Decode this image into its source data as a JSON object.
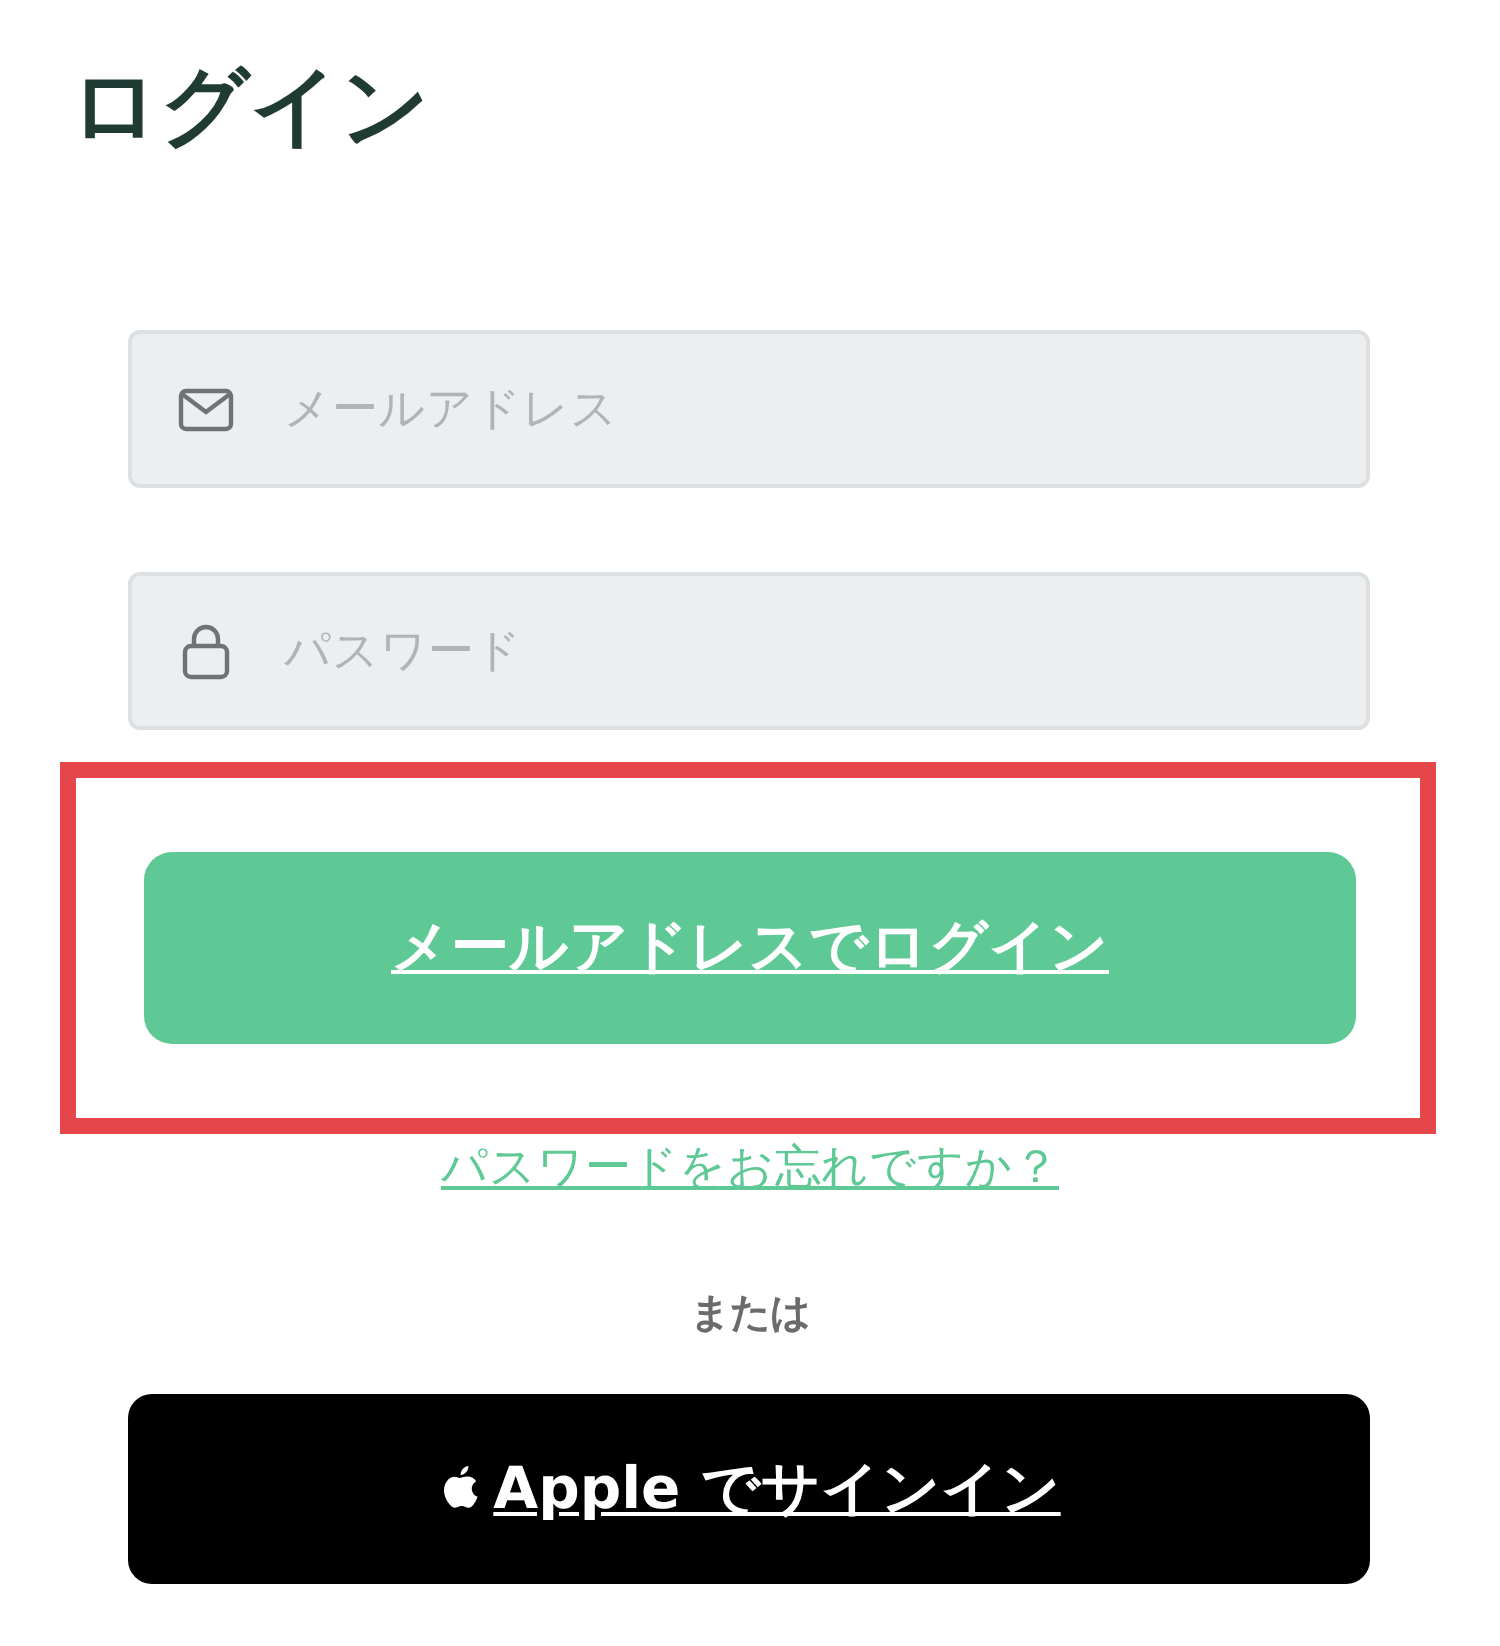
{
  "title": "ログイン",
  "fields": [
    {
      "kind": "email",
      "placeholder": "メールアドレス"
    },
    {
      "kind": "password",
      "placeholder": "パスワード"
    }
  ],
  "login_button": {
    "label": "メールアドレスでログイン",
    "highlighted": true
  },
  "forgot_link": "パスワードをお忘れですか？",
  "separator": "または",
  "apple_button": {
    "label": "Apple でサインイン"
  }
}
